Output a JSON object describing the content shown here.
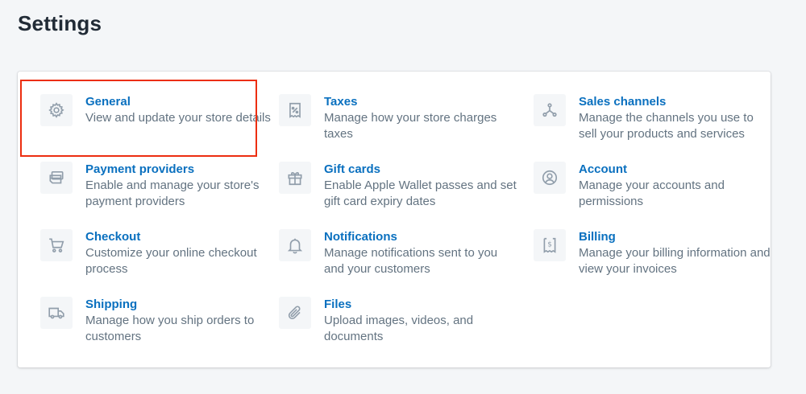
{
  "page": {
    "title": "Settings"
  },
  "settings": {
    "items": [
      {
        "title": "General",
        "desc": "View and update your store details",
        "icon": "gear-icon"
      },
      {
        "title": "Taxes",
        "desc": "Manage how your store charges taxes",
        "icon": "tax-receipt-icon"
      },
      {
        "title": "Sales channels",
        "desc": "Manage the channels you use to sell your products and services",
        "icon": "sales-channels-icon"
      },
      {
        "title": "Payment providers",
        "desc": "Enable and manage your store's payment providers",
        "icon": "payment-card-icon"
      },
      {
        "title": "Gift cards",
        "desc": "Enable Apple Wallet passes and set gift card expiry dates",
        "icon": "gift-icon"
      },
      {
        "title": "Account",
        "desc": "Manage your accounts and permissions",
        "icon": "account-icon"
      },
      {
        "title": "Checkout",
        "desc": "Customize your online checkout process",
        "icon": "cart-icon"
      },
      {
        "title": "Notifications",
        "desc": "Manage notifications sent to you and your customers",
        "icon": "bell-icon"
      },
      {
        "title": "Billing",
        "desc": "Manage your billing information and view your invoices",
        "icon": "billing-icon"
      },
      {
        "title": "Shipping",
        "desc": "Manage how you ship orders to customers",
        "icon": "truck-icon"
      },
      {
        "title": "Files",
        "desc": "Upload images, videos, and documents",
        "icon": "paperclip-icon"
      }
    ]
  },
  "colors": {
    "link": "#0a70bf",
    "text_subdued": "#637381",
    "icon": "#919eab",
    "highlight": "#ec2e10"
  }
}
